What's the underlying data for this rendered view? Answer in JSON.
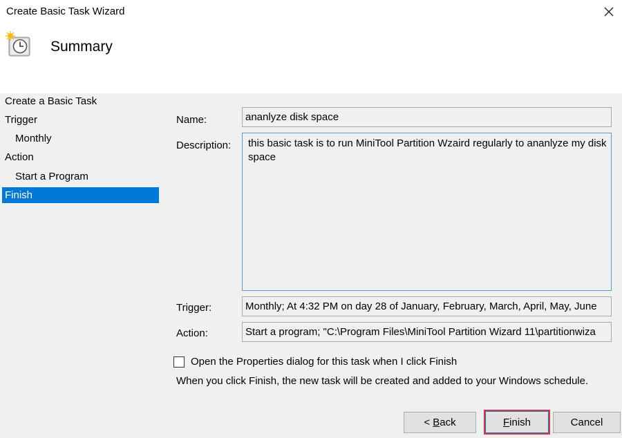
{
  "window": {
    "title": "Create Basic Task Wizard",
    "close_glyph": "✕",
    "app_icon": "task-scheduler-clock-icon"
  },
  "page": {
    "heading": "Summary"
  },
  "steps": [
    {
      "label": "Create a Basic Task",
      "sub": false,
      "active": false
    },
    {
      "label": "Trigger",
      "sub": false,
      "active": false
    },
    {
      "label": "Monthly",
      "sub": true,
      "active": false
    },
    {
      "label": "Action",
      "sub": false,
      "active": false
    },
    {
      "label": "Start a Program",
      "sub": true,
      "active": false
    },
    {
      "label": "Finish",
      "sub": false,
      "active": true
    }
  ],
  "summary": {
    "name_label": "Name:",
    "name_value": "ananlyze disk space",
    "description_label": "Description:",
    "description_value": "this basic task is to run MiniTool Partition Wzaird regularly to ananlyze my disk space",
    "trigger_label": "Trigger:",
    "trigger_value": "Monthly; At 4:32 PM  on day 28 of January, February, March, April, May, June",
    "action_label": "Action:",
    "action_value": "Start a program; \"C:\\Program Files\\MiniTool Partition Wizard 11\\partitionwiza"
  },
  "options": {
    "open_properties_label": "Open the Properties dialog for this task when I click Finish",
    "open_properties_checked": false,
    "info_text": "When you click Finish, the new task will be created and added to your Windows schedule."
  },
  "buttons": {
    "back_prefix": "< ",
    "back_mnemonic": "B",
    "back_rest": "ack",
    "finish_mnemonic": "F",
    "finish_rest": "inish",
    "cancel": "Cancel"
  },
  "colors": {
    "selection": "#0078d7",
    "highlight_box": "#e0353b",
    "focus_border": "#5b9bd5"
  }
}
